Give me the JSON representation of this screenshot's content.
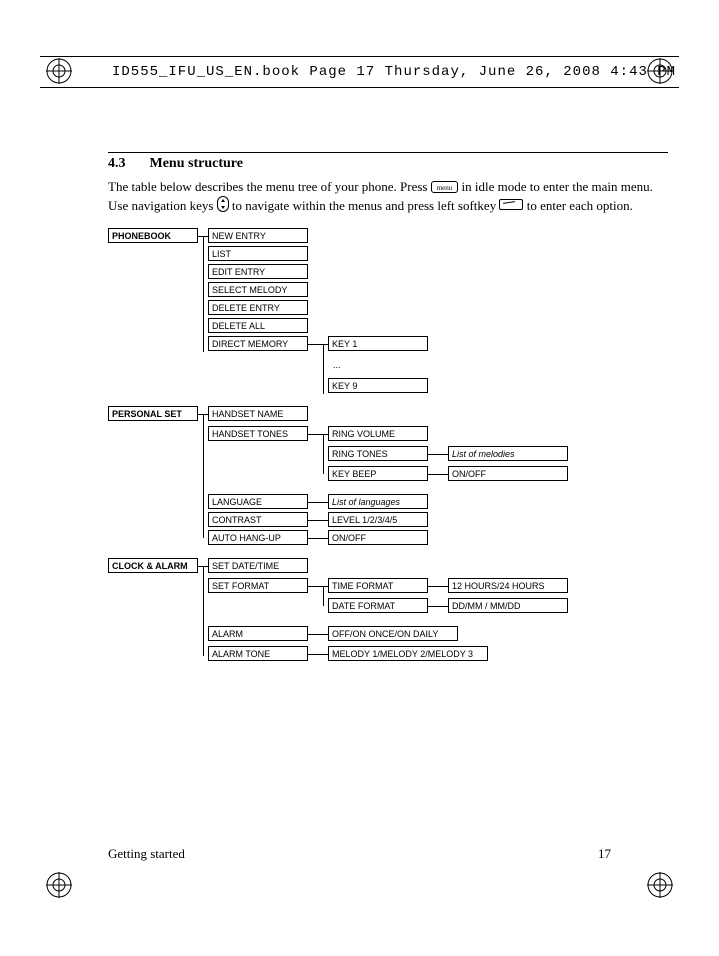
{
  "header_file": "ID555_IFU_US_EN.book  Page 17  Thursday, June 26, 2008  4:43 PM",
  "section_num": "4.3",
  "section_title": "Menu structure",
  "intro_a": "The table below describes the menu tree of your phone. Press ",
  "intro_b": " in idle mode to enter the main menu. Use navigation keys ",
  "intro_c": " to navigate within the menus and press left softkey ",
  "intro_d": " to enter each option.",
  "menu_key_label": "menu",
  "tree": {
    "phonebook": {
      "title": "PHONEBOOK",
      "items": [
        "NEW ENTRY",
        "LIST",
        "EDIT ENTRY",
        "SELECT MELODY",
        "DELETE ENTRY",
        "DELETE ALL",
        "DIRECT MEMORY"
      ],
      "direct": {
        "first": "KEY 1",
        "dots": "...",
        "last": "KEY 9"
      }
    },
    "personal": {
      "title": "PERSONAL SET",
      "items": [
        "HANDSET NAME",
        "HANDSET TONES",
        "LANGUAGE",
        "CONTRAST",
        "AUTO HANG-UP"
      ],
      "tones": [
        "RING VOLUME",
        "RING TONES",
        "KEY BEEP"
      ],
      "tones_v": [
        "List of melodies",
        "ON/OFF"
      ],
      "language_v": "List of languages",
      "contrast_v": "LEVEL 1/2/3/4/5",
      "autohang_v": "ON/OFF"
    },
    "clock": {
      "title": "CLOCK & ALARM",
      "items": [
        "SET DATE/TIME",
        "SET FORMAT",
        "ALARM",
        "ALARM TONE"
      ],
      "fmt": [
        "TIME FORMAT",
        "DATE FORMAT"
      ],
      "fmt_v": [
        "12 HOURS/24 HOURS",
        "DD/MM / MM/DD"
      ],
      "alarm_v": "OFF/ON ONCE/ON DAILY",
      "tone_v": "MELODY 1/MELODY 2/MELODY 3"
    }
  },
  "footer_left": "Getting started",
  "footer_right": "17"
}
